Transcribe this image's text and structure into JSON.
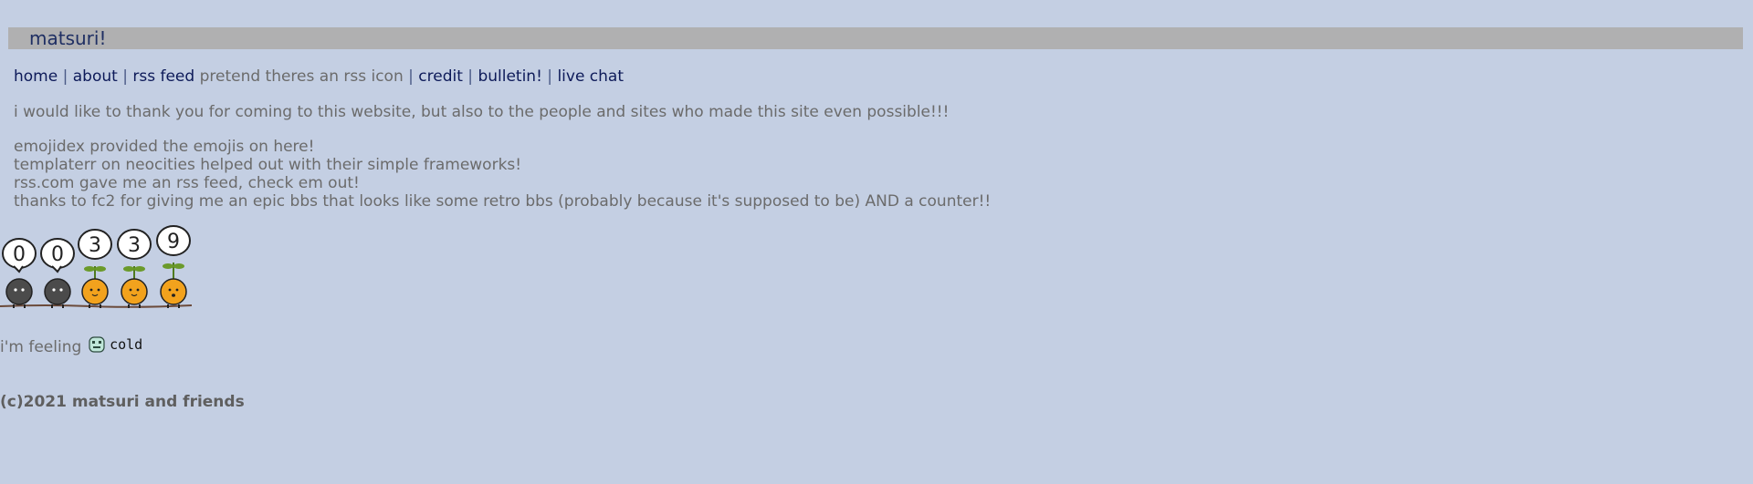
{
  "header": {
    "title": "matsuri!"
  },
  "nav": {
    "home": "home",
    "about": "about",
    "rss_feed": "rss feed",
    "rss_note": "pretend theres an rss icon",
    "credit": "credit",
    "bulletin": "bulletin!",
    "live_chat": "live chat",
    "separator": "|"
  },
  "intro": "i would like to thank you for coming to this website, but also to the people and sites who made this site even possible!!!",
  "credits": [
    "emojidex provided the emojis on here!",
    "templaterr on neocities helped out with their simple frameworks!",
    "rss.com gave me an rss feed, check em out!",
    "thanks to fc2 for giving me an epic bbs that looks like some retro bbs (probably because it's supposed to be) AND a counter!!"
  ],
  "counter": {
    "digits": [
      "0",
      "0",
      "3",
      "3",
      "9"
    ]
  },
  "mood": {
    "prefix": "i'm feeling",
    "label": "cold",
    "icon": "cold-face-icon"
  },
  "footer": "(c)2021 matsuri and friends",
  "colors": {
    "background": "#c4cfe3",
    "header_bar": "#b0b0b1",
    "link": "#0d1a59",
    "text": "#6b6b6b"
  }
}
